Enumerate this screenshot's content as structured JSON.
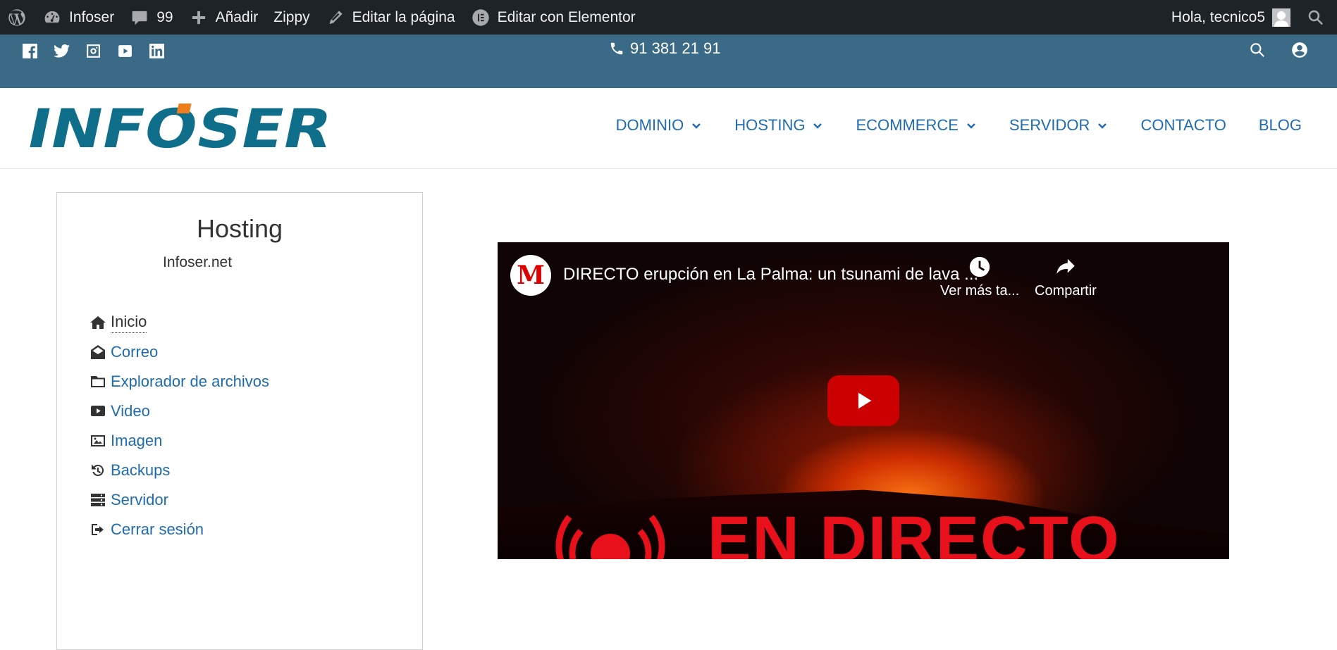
{
  "admin_bar": {
    "site_name": "Infoser",
    "comments_count": "99",
    "add_new": "Añadir",
    "zippy": "Zippy",
    "edit_page": "Editar la página",
    "edit_elementor": "Editar con Elementor",
    "greeting": "Hola, tecnico5"
  },
  "topbar": {
    "phone": "91 381 21 91",
    "social": [
      "facebook-icon",
      "twitter-icon",
      "instagram-icon",
      "youtube-icon",
      "linkedin-icon"
    ]
  },
  "header": {
    "logo_text": "INFOSER",
    "nav": [
      {
        "label": "DOMINIO",
        "dropdown": true
      },
      {
        "label": "HOSTING",
        "dropdown": true
      },
      {
        "label": "ECOMMERCE",
        "dropdown": true
      },
      {
        "label": "SERVIDOR",
        "dropdown": true
      },
      {
        "label": "CONTACTO",
        "dropdown": false
      },
      {
        "label": "BLOG",
        "dropdown": false
      }
    ]
  },
  "panel": {
    "title": "Hosting",
    "subtitle": "Infoser.net",
    "menu": [
      {
        "label": "Inicio",
        "icon": "home-icon"
      },
      {
        "label": "Correo",
        "icon": "envelope-open-icon"
      },
      {
        "label": "Explorador de archivos",
        "icon": "folder-icon"
      },
      {
        "label": "Video",
        "icon": "youtube-icon"
      },
      {
        "label": "Imagen",
        "icon": "image-icon"
      },
      {
        "label": "Backups",
        "icon": "backup-icon"
      },
      {
        "label": "Servidor",
        "icon": "server-icon"
      },
      {
        "label": "Cerrar sesión",
        "icon": "logout-icon"
      }
    ]
  },
  "video": {
    "channel_logo": "M",
    "title": "DIRECTO erupción en La Palma: un tsunami de lava ...",
    "watch_later": "Ver más ta...",
    "share": "Compartir",
    "overlay_text": "EN DIRECTO"
  },
  "colors": {
    "admin_bar": "#1d2327",
    "topbar": "#3b6a87",
    "link": "#1f6bb0",
    "logo_teal": "#0f6f8a",
    "logo_orange": "#f07d1c"
  }
}
